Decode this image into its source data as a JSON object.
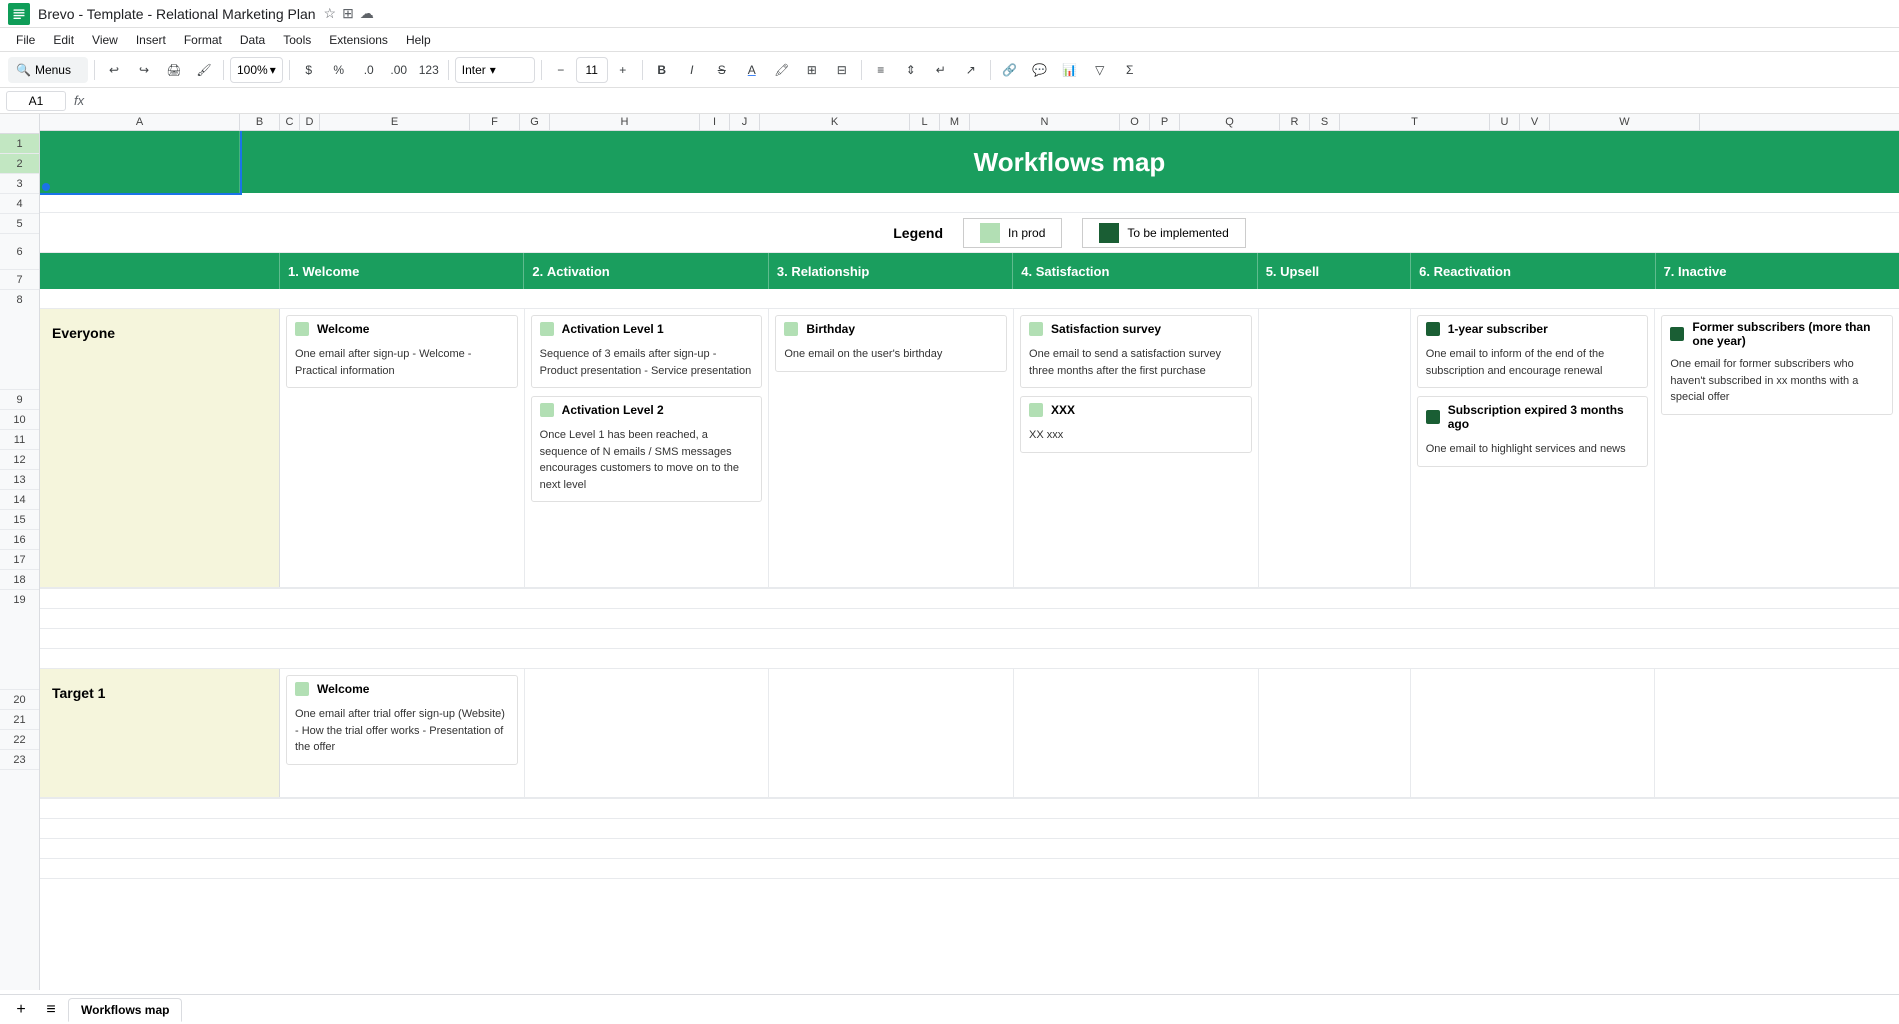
{
  "app": {
    "title": "Brevo - Template - Relational Marketing Plan",
    "logo_color": "#0F9D58"
  },
  "menubar": {
    "items": [
      "File",
      "Edit",
      "View",
      "Insert",
      "Format",
      "Data",
      "Tools",
      "Extensions",
      "Help"
    ]
  },
  "toolbar": {
    "zoom": "100%",
    "font": "Inter",
    "font_size": "11",
    "search_label": "Menus"
  },
  "cell_ref": "A1",
  "spreadsheet": {
    "title": "Workflows map",
    "legend": {
      "label": "Legend",
      "in_prod": {
        "label": "In prod",
        "color": "#b2dfb4"
      },
      "to_implement": {
        "label": "To be implemented",
        "color": "#1a5e34"
      }
    },
    "categories": [
      {
        "num": "1.",
        "label": "Welcome"
      },
      {
        "num": "2.",
        "label": "Activation"
      },
      {
        "num": "3.",
        "label": "Relationship"
      },
      {
        "num": "4.",
        "label": "Satisfaction"
      },
      {
        "num": "5.",
        "label": "Upsell"
      },
      {
        "num": "6.",
        "label": "Reactivation"
      },
      {
        "num": "7.",
        "label": "Inactive"
      }
    ],
    "sections": [
      {
        "label": "Everyone",
        "cards": [
          {
            "col": 0,
            "title": "Welcome",
            "indicator": "green",
            "body": "One email after sign-up\n  - Welcome\n  - Practical information"
          },
          {
            "col": 1,
            "title": "Activation Level 1",
            "indicator": "green",
            "body": "Sequence of 3 emails after sign-up\n  - Product presentation\n  - Service presentation"
          },
          {
            "col": 1,
            "title": "Activation Level 2",
            "indicator": "green",
            "body": "Once Level 1 has been reached, a sequence of N emails / SMS messages encourages customers to move on to the next level"
          },
          {
            "col": 2,
            "title": "Birthday",
            "indicator": "green",
            "body": "One email on the user's birthday"
          },
          {
            "col": 3,
            "title": "Satisfaction survey",
            "indicator": "green",
            "body": "One email to send a satisfaction survey three months after the first purchase"
          },
          {
            "col": 3,
            "title": "XXX",
            "indicator": "green",
            "body": "XX   xxx"
          },
          {
            "col": 5,
            "title": "1-year subscriber",
            "indicator": "dark-green",
            "body": "One email to inform of the end of the subscription and encourage renewal"
          },
          {
            "col": 5,
            "title": "Subscription expired 3 months ago",
            "indicator": "dark-green",
            "body": "One email to highlight services and news"
          },
          {
            "col": 6,
            "title": "Former subscribers (more than one year)",
            "indicator": "dark-green",
            "body": "One email for former subscribers who haven't subscribed in xx months with a special offer"
          }
        ]
      },
      {
        "label": "Target 1",
        "cards": [
          {
            "col": 0,
            "title": "Welcome",
            "indicator": "green",
            "body": "One email after trial offer sign-up (Website)\n  - How the trial offer works\n  - Presentation of the offer"
          }
        ]
      }
    ],
    "sheet_tab": "Workflows map"
  }
}
